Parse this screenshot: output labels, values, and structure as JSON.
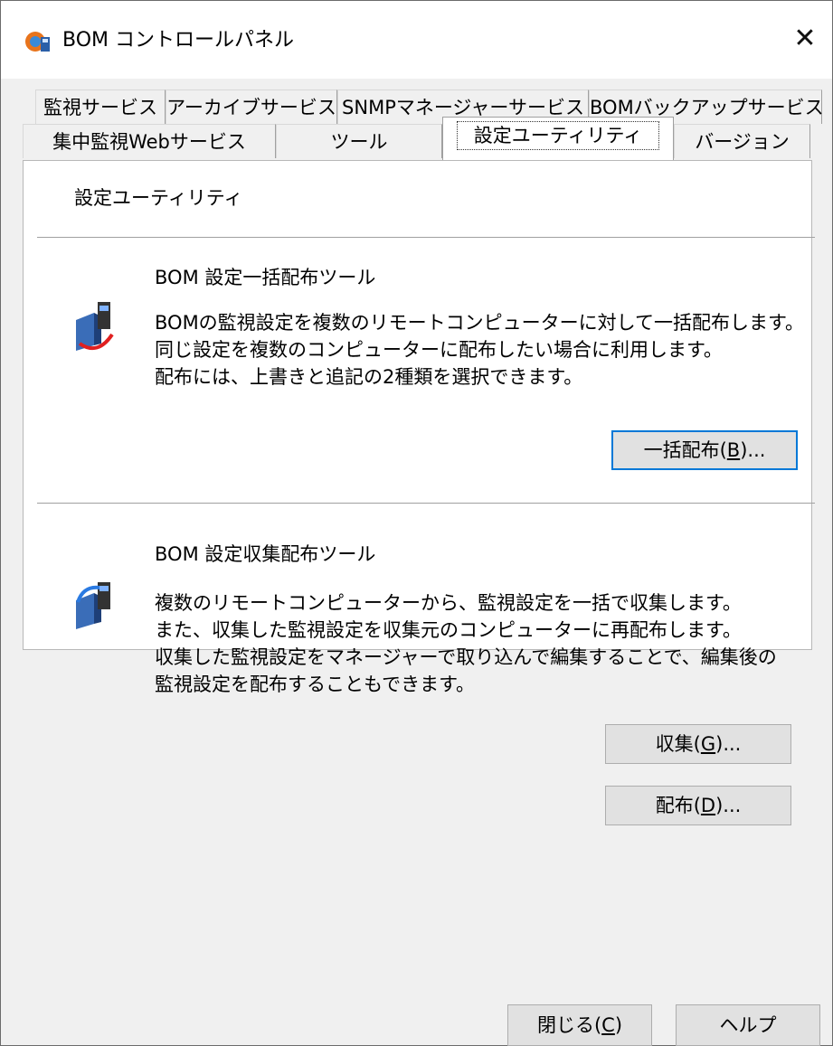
{
  "window": {
    "title": "BOM コントロールパネル",
    "close_glyph": "✕"
  },
  "tabs": {
    "row1": [
      "監視サービス",
      "アーカイブサービス",
      "SNMPマネージャーサービス",
      "BOMバックアップサービス"
    ],
    "row2": [
      "集中監視Webサービス",
      "ツール",
      "設定ユーティリティ",
      "バージョン"
    ],
    "selected": "設定ユーティリティ"
  },
  "panel": {
    "title": "設定ユーティリティ",
    "bulk": {
      "title": "BOM 設定一括配布ツール",
      "lines": [
        "BOMの監視設定を複数のリモートコンピューターに対して一括配布します。",
        "同じ設定を複数のコンピューターに配布したい場合に利用します。",
        "配布には、上書きと追記の2種類を選択できます。"
      ],
      "button": {
        "label": "一括配布(",
        "key": "B",
        "suffix": ")..."
      }
    },
    "collect": {
      "title": "BOM 設定収集配布ツール",
      "lines": [
        "複数のリモートコンピューターから、監視設定を一括で収集します。",
        "また、収集した監視設定を収集元のコンピューターに再配布します。",
        "収集した監視設定をマネージャーで取り込んで編集することで、編集後の",
        "監視設定を配布することもできます。"
      ],
      "collect_button": {
        "label": "収集(",
        "key": "G",
        "suffix": ")..."
      },
      "distribute_button": {
        "label": "配布(",
        "key": "D",
        "suffix": ")..."
      }
    }
  },
  "footer": {
    "close_button": {
      "label": "閉じる(",
      "key": "C",
      "suffix": ")"
    },
    "help_button": "ヘルプ"
  },
  "colors": {
    "accent": "#0078d7",
    "panel_bg": "#ffffff",
    "window_bg": "#f0f0f0"
  }
}
